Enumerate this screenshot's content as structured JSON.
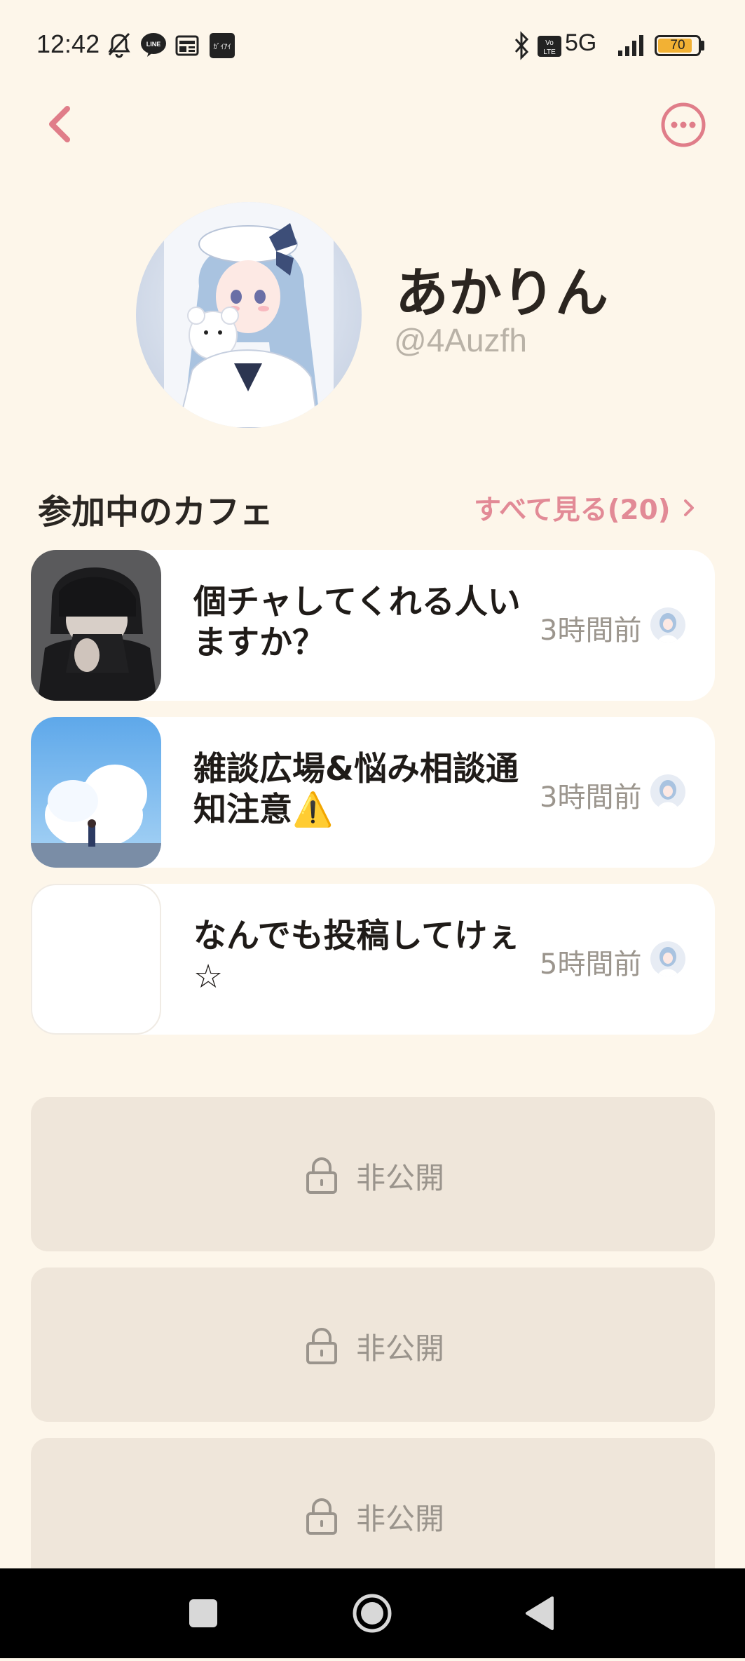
{
  "status_bar": {
    "time": "12:42",
    "network": "5G",
    "battery": "70",
    "notification_icons": [
      "mute-bell-icon",
      "line-icon",
      "news-icon",
      "app-icon"
    ],
    "right_icons": [
      "bluetooth-icon",
      "volte-icon",
      "signal-icon",
      "battery-icon"
    ]
  },
  "header": {
    "back_icon": "chevron-left-icon",
    "menu_icon": "more-horizontal-icon",
    "accent_color": "#e07d89"
  },
  "profile": {
    "name": "あかりん",
    "handle": "@4Auzfh"
  },
  "cafes_section": {
    "title": "参加中のカフェ",
    "see_all": "すべて見る(20)",
    "items": [
      {
        "title": "個チャしてくれる人いますか？",
        "time": "3時間前",
        "thumb": "dark-hooded-boy"
      },
      {
        "title": "雑談広場&悩み相談通知注意⚠️",
        "time": "3時間前",
        "thumb": "sky-cloud-girl"
      },
      {
        "title": "なんでも投稿してけぇ☆",
        "time": "5時間前",
        "thumb": "blank"
      }
    ]
  },
  "private_items": [
    {
      "label": "非公開"
    },
    {
      "label": "非公開"
    },
    {
      "label": "非公開"
    }
  ],
  "nav_bar": {
    "buttons": [
      "recents-square-icon",
      "home-circle-icon",
      "back-triangle-icon"
    ]
  }
}
